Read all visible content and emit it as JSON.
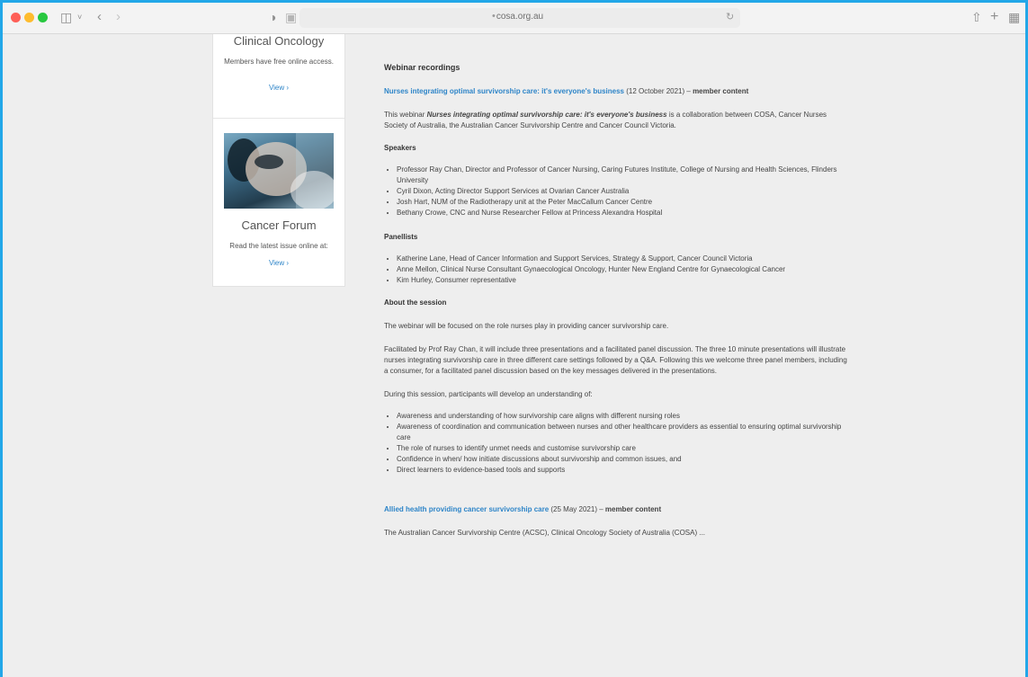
{
  "browser": {
    "url": "cosa.org.au",
    "traffic_lights": [
      "#fe5f57",
      "#febc2e",
      "#28c840"
    ]
  },
  "sidebar": {
    "pub1": {
      "title": "Clinical Oncology",
      "desc": "Members have free online access.",
      "link": "View ›"
    },
    "pub2": {
      "title": "Cancer Forum",
      "desc": "Read the latest issue online at:",
      "link": "View ›"
    }
  },
  "content": {
    "section_title": "Webinar recordings",
    "webinar1": {
      "link": "Nurses integrating optimal survivorship care: it's everyone's business",
      "date": " (12 October 2021) – ",
      "tag": "member content",
      "intro_prefix": "This webinar ",
      "intro_em": "Nurses integrating optimal survivorship care: it's everyone's business",
      "intro_suffix": " is a collaboration between COSA, Cancer Nurses Society of Australia, the Australian Cancer Survivorship Centre and Cancer Council Victoria.",
      "speakers_h": "Speakers",
      "speakers": [
        "Professor Ray Chan, Director and Professor of Cancer Nursing, Caring Futures Institute, College of Nursing and Health Sciences, Flinders University",
        "Cyril Dixon, Acting Director Support Services at Ovarian Cancer Australia",
        "Josh Hart, NUM of the Radiotherapy unit at the Peter MacCallum Cancer Centre",
        "Bethany Crowe, CNC and Nurse Researcher Fellow at Princess Alexandra Hospital"
      ],
      "panellists_h": "Panellists",
      "panellists": [
        "Katherine Lane, Head of Cancer Information and Support Services, Strategy & Support, Cancer Council Victoria",
        "Anne Mellon, Clinical Nurse Consultant Gynaecological Oncology, Hunter New England Centre for Gynaecological Cancer",
        "Kim Hurley, Consumer representative"
      ],
      "about_h": "About the session",
      "about_p1": "The webinar will be focused on the role nurses play in providing cancer survivorship care.",
      "about_p2": "Facilitated by Prof Ray Chan, it will include three presentations and a facilitated panel discussion. The three 10 minute presentations will illustrate nurses integrating survivorship care in three different care settings followed by a Q&A. Following this we welcome three panel members, including a consumer, for a facilitated panel discussion based on the key messages delivered in the presentations.",
      "about_p3": "During this session, participants will develop an understanding of:",
      "outcomes": [
        "Awareness and understanding of how survivorship care aligns with different nursing roles",
        "Awareness of coordination and communication between nurses and other healthcare providers as essential to ensuring optimal survivorship care",
        "The role of nurses to identify unmet needs and customise survivorship care",
        "Confidence in when/ how initiate discussions about survivorship and common issues, and",
        "Direct learners to evidence-based tools and supports"
      ]
    },
    "webinar2": {
      "link": "Allied health providing cancer survivorship care",
      "date": " (25 May 2021) – ",
      "tag": "member content",
      "intro": "The Australian Cancer Survivorship Centre (ACSC), Clinical Oncology Society of Australia (COSA) ..."
    }
  }
}
